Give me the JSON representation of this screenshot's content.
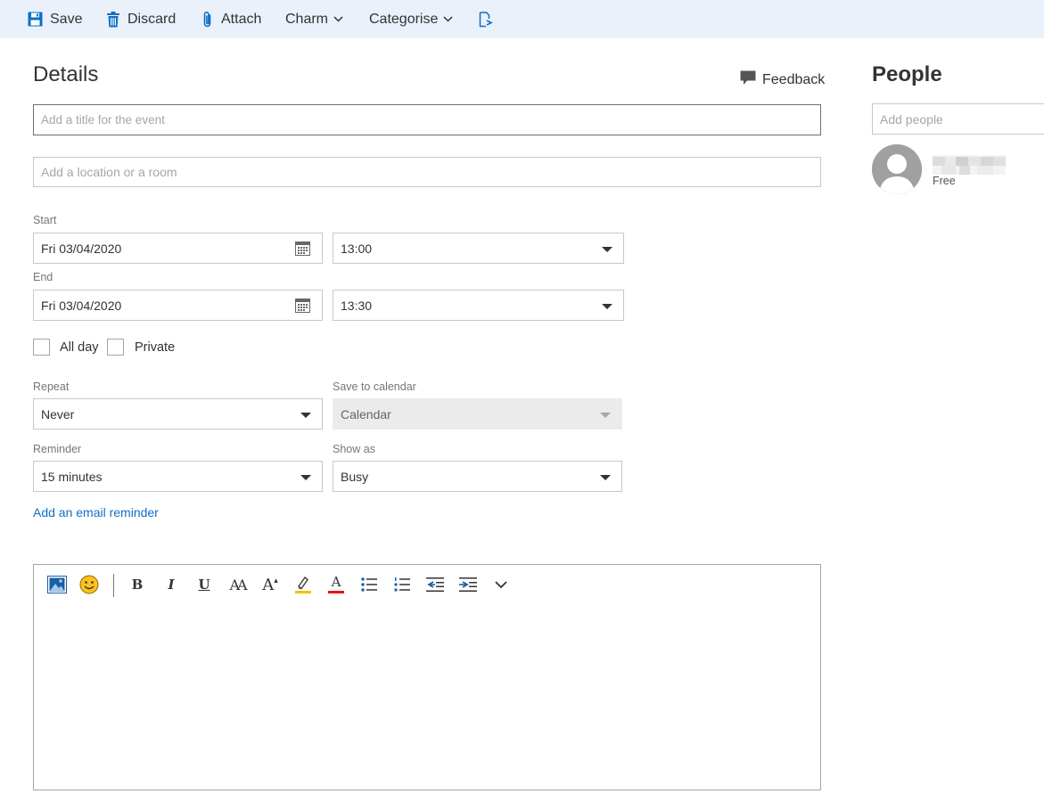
{
  "toolbar": {
    "save_label": "Save",
    "discard_label": "Discard",
    "attach_label": "Attach",
    "charm_label": "Charm",
    "categorise_label": "Categorise",
    "accent_color": "#0f6fc6",
    "background_color": "#eaf1fb"
  },
  "details": {
    "heading": "Details",
    "feedback_label": "Feedback",
    "title_placeholder": "Add a title for the event",
    "title_value": "",
    "location_placeholder": "Add a location or a room",
    "location_value": ""
  },
  "start": {
    "label": "Start",
    "date": "Fri 03/04/2020",
    "time": "13:00"
  },
  "end": {
    "label": "End",
    "date": "Fri 03/04/2020",
    "time": "13:30"
  },
  "options": {
    "all_day_label": "All day",
    "all_day_checked": false,
    "private_label": "Private",
    "private_checked": false
  },
  "repeat": {
    "label": "Repeat",
    "value": "Never"
  },
  "save_to_calendar": {
    "label": "Save to calendar",
    "value": "Calendar",
    "disabled": true
  },
  "reminder": {
    "label": "Reminder",
    "value": "15 minutes"
  },
  "show_as": {
    "label": "Show as",
    "value": "Busy"
  },
  "email_reminder_link": "Add an email reminder",
  "editor_toolbar": {
    "buttons": [
      "insert-picture-icon",
      "emoji-icon",
      "bold-icon",
      "italic-icon",
      "underline-icon",
      "font-size-icon",
      "grow-font-icon",
      "highlight-icon",
      "font-color-icon",
      "bullets-icon",
      "numbering-icon",
      "decrease-indent-icon",
      "increase-indent-icon",
      "more-options-icon"
    ],
    "bold_glyph": "B",
    "italic_glyph": "I",
    "underline_glyph": "U",
    "font_size_glyph": "AA",
    "grow_font_glyph": "A",
    "font_color_glyph": "A",
    "highlight_color": "#f2c200",
    "font_color": "#e81123"
  },
  "people": {
    "heading": "People",
    "add_placeholder": "Add people",
    "attendees": [
      {
        "status": "Free"
      }
    ]
  }
}
